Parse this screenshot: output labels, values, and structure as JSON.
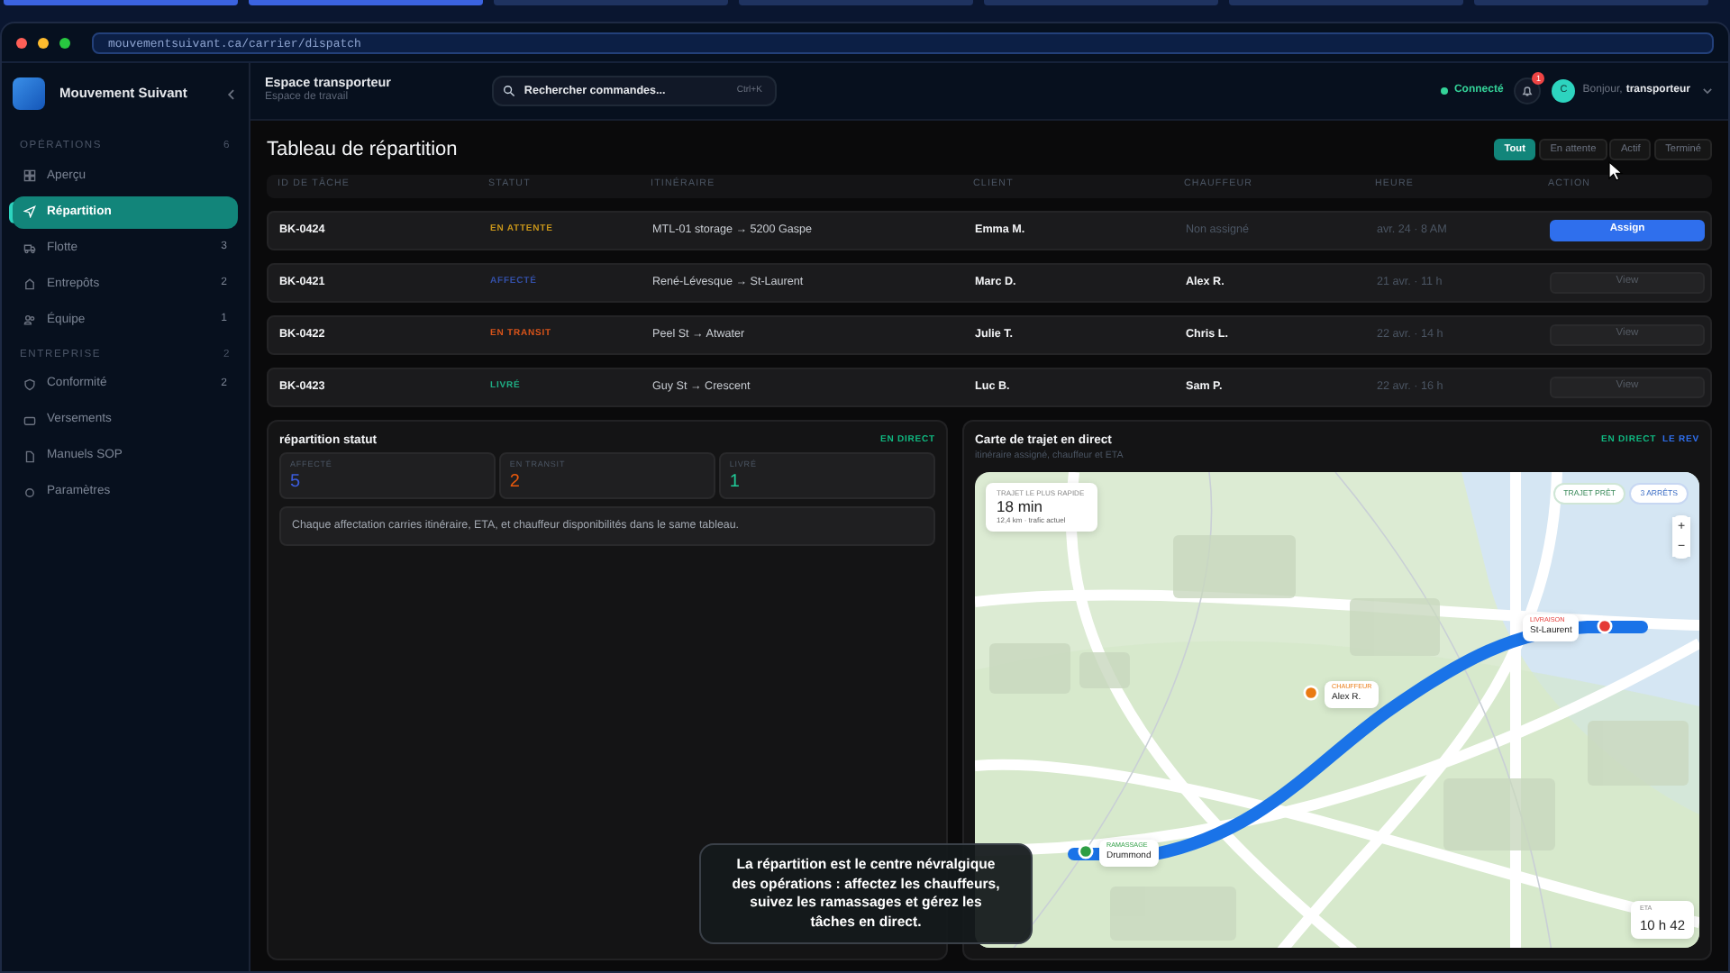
{
  "browser": {
    "url": "mouvementsuivant.ca/carrier/dispatch"
  },
  "sidebar": {
    "brand": "Mouvement Suivant",
    "sections": [
      {
        "title": "OPÉRATIONS",
        "count": "6",
        "items": [
          {
            "label": "Aperçu",
            "selected": false
          },
          {
            "label": "Répartition",
            "selected": true
          },
          {
            "label": "Flotte",
            "count": "3",
            "selected": false
          },
          {
            "label": "Entrepôts",
            "count": "2",
            "selected": false
          },
          {
            "label": "Équipe",
            "count": "1",
            "selected": false
          }
        ]
      },
      {
        "title": "ENTREPRISE",
        "count": "2",
        "items": [
          {
            "label": "Conformité",
            "count": "2",
            "selected": false
          },
          {
            "label": "Versements",
            "selected": false
          },
          {
            "label": "Manuels SOP",
            "selected": false
          },
          {
            "label": "Paramètres",
            "selected": false
          }
        ]
      }
    ]
  },
  "header": {
    "title": "Espace transporteur",
    "subtitle": "Espace de travail",
    "search": {
      "placeholder": "Rechercher commandes...",
      "shortcut": "Ctrl+K"
    },
    "status": "Connecté",
    "notifications": "1",
    "avatar": "C",
    "greeting": "Bonjour,",
    "user": "transporteur"
  },
  "page": {
    "title": "Tableau de répartition",
    "filters": [
      {
        "label": "Tout",
        "selected": true
      },
      {
        "label": "En attente",
        "selected": false
      },
      {
        "label": "Actif",
        "selected": false
      },
      {
        "label": "Terminé",
        "selected": false
      }
    ]
  },
  "table": {
    "columns": [
      "ID DE TÂCHE",
      "STATUT",
      "ITINÉRAIRE",
      "CLIENT",
      "CHAUFFEUR",
      "HEURE",
      "ACTION"
    ],
    "rows": [
      {
        "id": "BK-0424",
        "status": "EN ATTENTE",
        "kind": "pending",
        "route": "MTL-01 storage → 5200 Gaspe",
        "client": "Emma M.",
        "driver": "Non assigné",
        "unassigned": true,
        "time": "avr. 24 · 8 AM",
        "action": "Assign",
        "primary": true
      },
      {
        "id": "BK-0421",
        "status": "AFFECTÉ",
        "kind": "assigned",
        "route": "René-Lévesque → St-Laurent",
        "client": "Marc D.",
        "driver": "Alex R.",
        "unassigned": false,
        "time": "21 avr. · 11 h",
        "action": "View",
        "primary": false
      },
      {
        "id": "BK-0422",
        "status": "EN TRANSIT",
        "kind": "transit",
        "route": "Peel St → Atwater",
        "client": "Julie T.",
        "driver": "Chris L.",
        "unassigned": false,
        "time": "22 avr. · 14 h",
        "action": "View",
        "primary": false
      },
      {
        "id": "BK-0423",
        "status": "LIVRÉ",
        "kind": "delivered",
        "route": "Guy St → Crescent",
        "client": "Luc B.",
        "driver": "Sam P.",
        "unassigned": false,
        "time": "22 avr. · 16 h",
        "action": "View",
        "primary": false
      }
    ]
  },
  "status_panel": {
    "title": "répartition statut",
    "badge": "EN DIRECT",
    "stats": [
      {
        "label": "AFFECTÉ",
        "value": "5",
        "color": "#3b5bdb"
      },
      {
        "label": "EN TRANSIT",
        "value": "2",
        "color": "#e8590c"
      },
      {
        "label": "LIVRÉ",
        "value": "1",
        "color": "#20c997"
      }
    ],
    "note": "Chaque affectation carries itinéraire, ETA, et chauffeur disponibilités dans le same tableau."
  },
  "map_panel": {
    "title": "Carte de trajet en direct",
    "subtitle": "itinéraire assigné, chauffeur et ETA",
    "badges": [
      {
        "label": "EN DIRECT",
        "kind": "live"
      },
      {
        "label": "LE REV",
        "kind": "info"
      }
    ],
    "route_card": {
      "label": "TRAJET LE PLUS RAPIDE",
      "duration": "18 min",
      "detail": "12,4 km · trafic actuel"
    },
    "chips": [
      {
        "label": "TRAJET PRÊT",
        "kind": "ready"
      },
      {
        "label": "3 ARRÊTS",
        "kind": "stops"
      }
    ],
    "zoom": [
      "+",
      "−"
    ],
    "markers": [
      {
        "kind": "pickup",
        "label": "RAMASSAGE",
        "place": "Drummond"
      },
      {
        "kind": "driver",
        "label": "CHAUFFEUR",
        "place": "Alex R."
      },
      {
        "kind": "delivery",
        "label": "LIVRAISON",
        "place": "St-Laurent"
      }
    ],
    "eta": {
      "label": "ETA",
      "value": "10 h 42"
    }
  },
  "caption": "La répartition est le centre névralgique des opérations : affectez les chauffeurs, suivez les ramassages et gérez les tâches en direct."
}
